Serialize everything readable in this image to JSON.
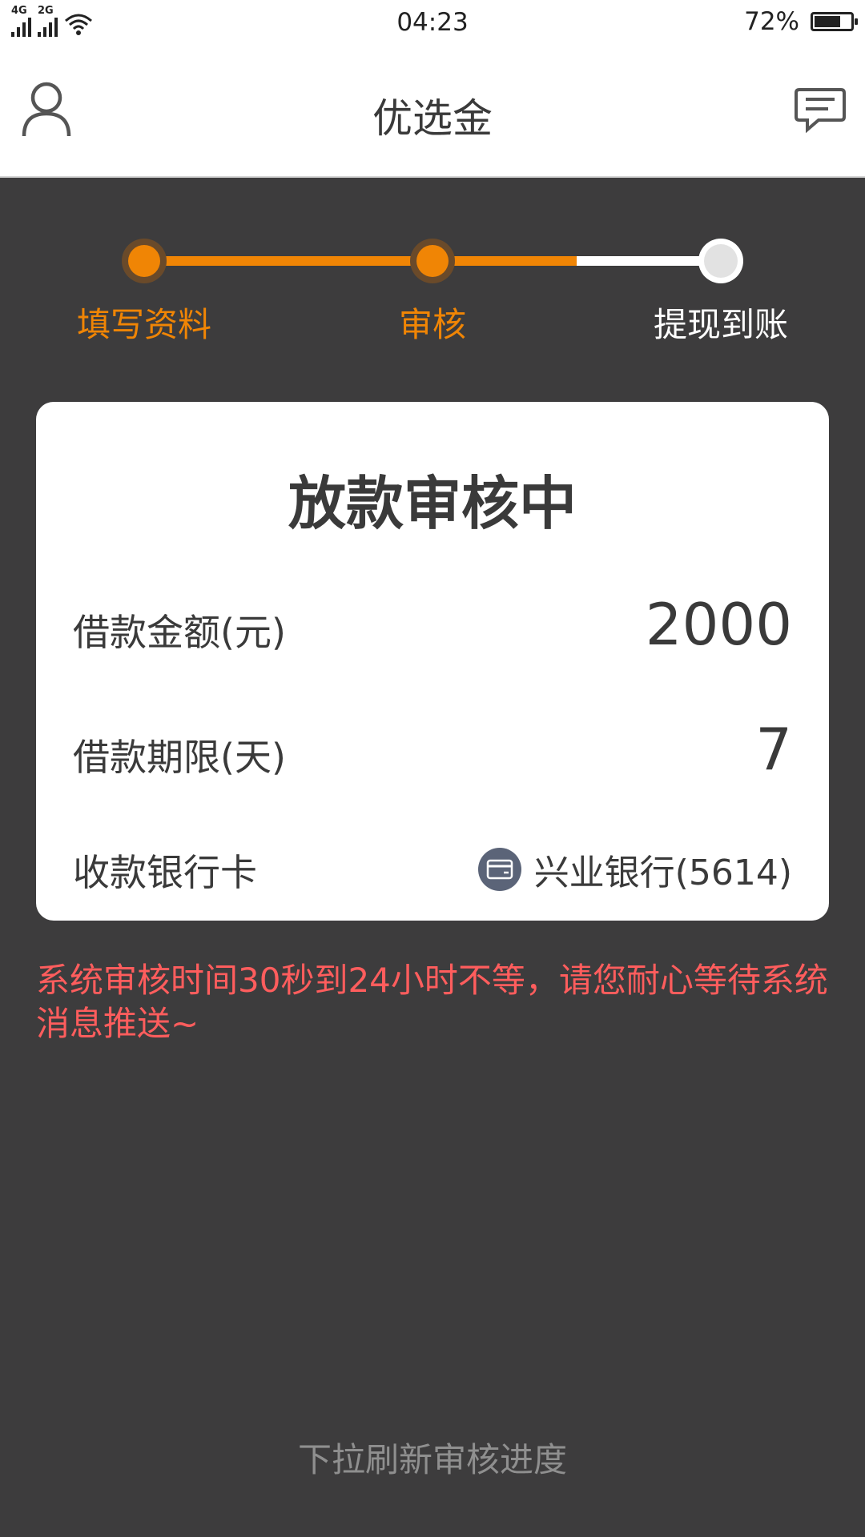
{
  "status_bar": {
    "network1": "4G",
    "network2": "2G",
    "time": "04:23",
    "battery_percent": "72%",
    "battery_level": 0.72
  },
  "header": {
    "title": "优选金"
  },
  "stepper": {
    "steps": [
      {
        "label": "填写资料",
        "state": "done"
      },
      {
        "label": "审核",
        "state": "done"
      },
      {
        "label": "提现到账",
        "state": "pending"
      }
    ],
    "progress_fraction": 0.75,
    "accent_color": "#f08505"
  },
  "card": {
    "title": "放款审核中",
    "amount_label": "借款金额(元)",
    "amount_value": "2000",
    "term_label": "借款期限(天)",
    "term_value": "7",
    "bank_label": "收款银行卡",
    "bank_value": "兴业银行(5614)"
  },
  "notice": "系统审核时间30秒到24小时不等，请您耐心等待系统消息推送~",
  "refresh_hint": "下拉刷新审核进度"
}
